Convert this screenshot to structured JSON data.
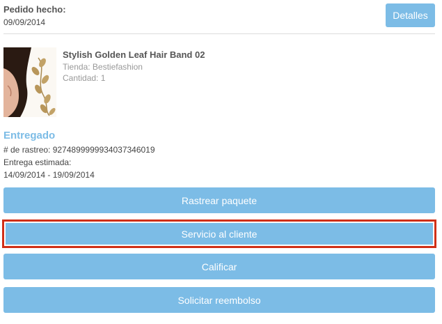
{
  "order": {
    "label": "Pedido hecho:",
    "date": "09/09/2014",
    "details_button": "Detalles"
  },
  "product": {
    "name": "Stylish Golden Leaf Hair Band 02",
    "store": "Tienda: Bestiefashion",
    "quantity": "Cantidad: 1",
    "thumbnail_icon": "product-photo"
  },
  "shipment": {
    "status": "Entregado",
    "tracking": "# de rastreo: 9274899999934037346019",
    "estimate_label": "Entrega estimada:",
    "estimate_range": "14/09/2014 - 19/09/2014"
  },
  "actions": {
    "track": "Rastrear paquete",
    "customer_service": "Servicio al cliente",
    "rate": "Calificar",
    "refund": "Solicitar reembolso"
  },
  "colors": {
    "accent": "#7cbce6",
    "highlight_border": "#d02f17"
  }
}
